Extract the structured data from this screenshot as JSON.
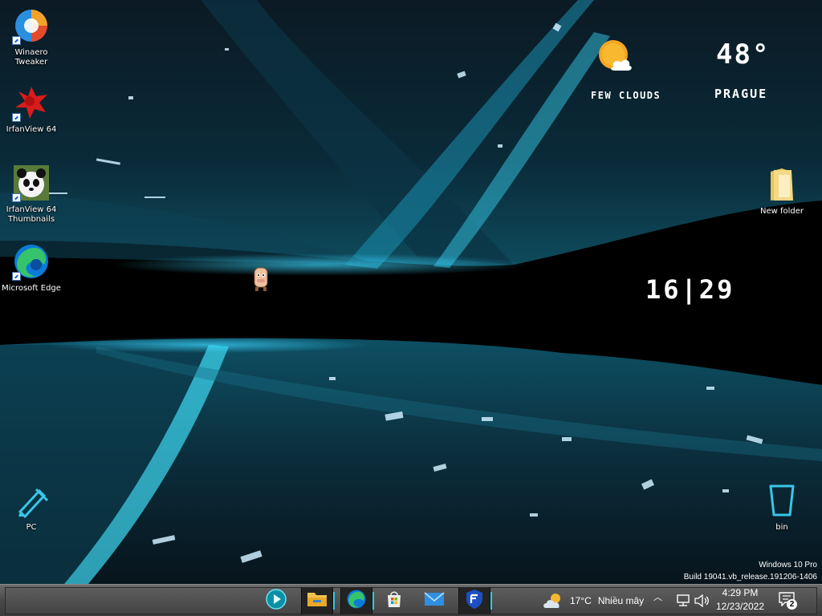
{
  "desktop": {
    "icons": [
      {
        "label": "Winaero\nTweaker"
      },
      {
        "label": "IrfanView 64"
      },
      {
        "label": "IrfanView 64\nThumbnails"
      },
      {
        "label": "Microsoft Edge"
      },
      {
        "label": "New folder"
      },
      {
        "label": "PC"
      },
      {
        "label": "bin"
      }
    ],
    "weather_widget": {
      "condition": "FEW CLOUDS",
      "temperature": "48°",
      "city": "PRAGUE",
      "icon": "sun-cloud-icon"
    },
    "clock_widget": {
      "time": "16|29"
    },
    "watermark": {
      "line1": "Windows 10 Pro",
      "line2": "Build 19041.vb_release.191206-1406"
    }
  },
  "taskbar": {
    "apps": [
      {
        "name": "media-player-icon"
      },
      {
        "name": "file-explorer-icon"
      },
      {
        "name": "edge-icon"
      },
      {
        "name": "microsoft-store-icon"
      },
      {
        "name": "mail-icon"
      },
      {
        "name": "shield-app-icon"
      }
    ],
    "weather": {
      "temp": "17°C",
      "condition": "Nhiều mây"
    },
    "time": "4:29 PM",
    "date": "12/23/2022",
    "notification_count": "2"
  }
}
